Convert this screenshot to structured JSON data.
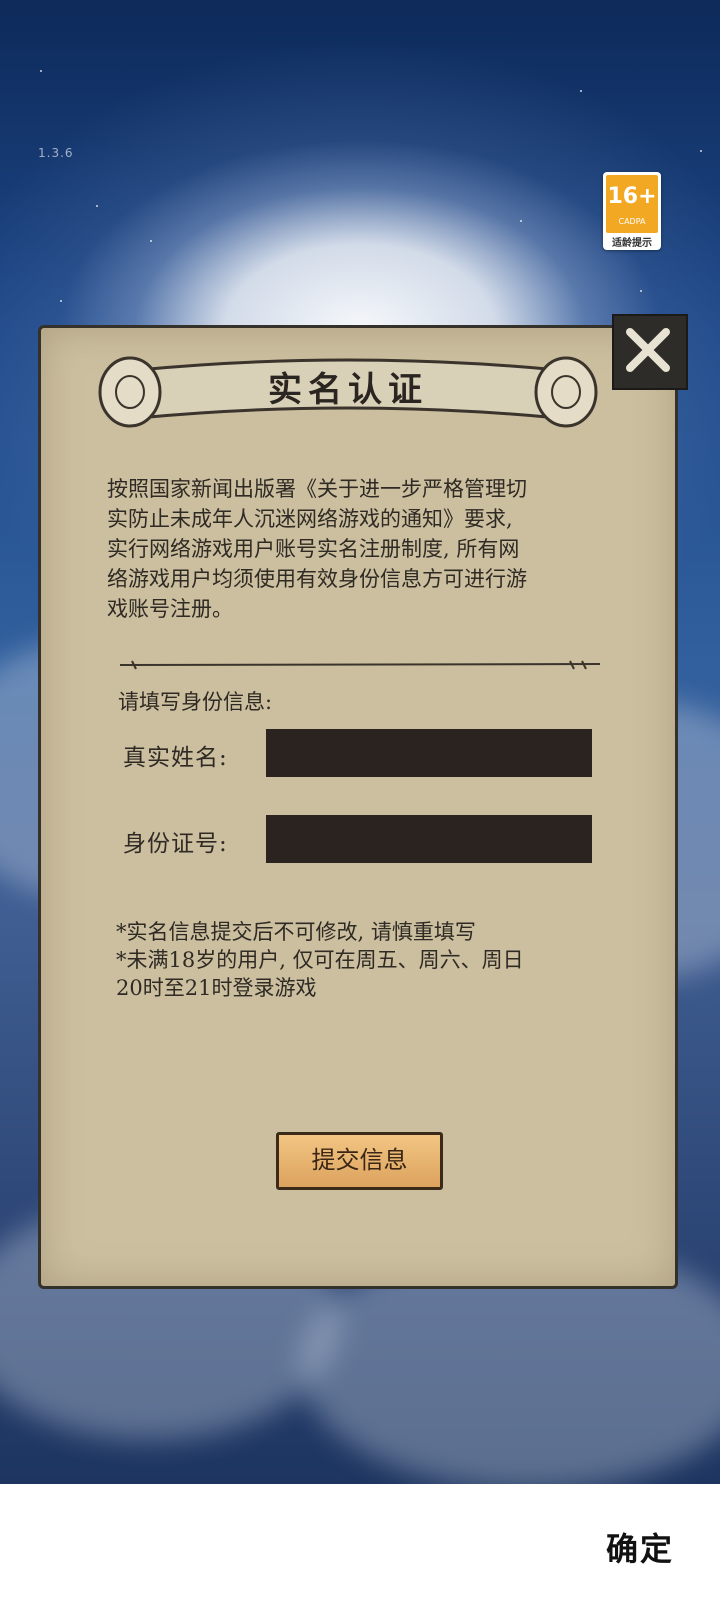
{
  "version": "1.3.6",
  "age_rating": {
    "value": "16+",
    "org": "CADPA",
    "tip": "适龄提示"
  },
  "dialog": {
    "title": "实名认证",
    "notice_lines": [
      "按照国家新闻出版署《关于进一步严格管理切",
      "实防止未成年人沉迷网络游戏的通知》要求,",
      "实行网络游戏用户账号实名注册制度, 所有网",
      "络游戏用户均须使用有效身份信息方可进行游",
      "戏账号注册。"
    ],
    "section_label": "请填写身份信息:",
    "name_label": "真实姓名:",
    "id_label": "身份证号:",
    "hint_lines": [
      "*实名信息提交后不可修改, 请慎重填写",
      "*未满18岁的用户, 仅可在周五、周六、周日",
      "20时至21时登录游戏"
    ],
    "submit_label": "提交信息"
  },
  "footer": {
    "confirm_label": "确定"
  },
  "colors": {
    "paper": "#cbbf9f",
    "input": "#2a2320",
    "button": "#e6b26f",
    "badge": "#f2a823"
  },
  "icons": {
    "close": "close-x-icon"
  }
}
